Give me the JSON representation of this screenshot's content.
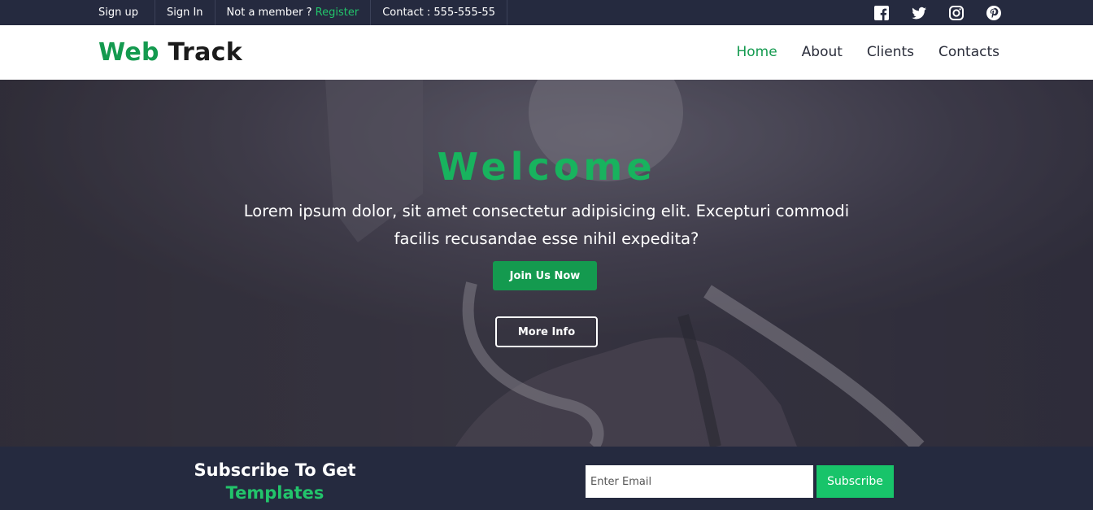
{
  "topbar": {
    "signup": "Sign up",
    "signin": "Sign In",
    "member_prefix": "Not a member ?",
    "register": "Register",
    "contact": "Contact : 555-555-55",
    "social_icons": [
      "facebook-icon",
      "twitter-icon",
      "instagram-icon",
      "pinterest-icon"
    ]
  },
  "nav": {
    "logo_part1": "Web",
    "logo_part2": "Track",
    "items": [
      {
        "label": "Home",
        "active": true
      },
      {
        "label": "About",
        "active": false
      },
      {
        "label": "Clients",
        "active": false
      },
      {
        "label": "Contacts",
        "active": false
      }
    ]
  },
  "hero": {
    "title": "Welcome",
    "text": "Lorem ipsum dolor, sit amet consectetur adipisicing elit. Excepturi commodi facilis recusandae esse nihil expedita?",
    "join_label": "Join Us Now",
    "more_label": "More Info"
  },
  "subscribe": {
    "title_line1": "Subscribe To Get",
    "title_line2": "Templates",
    "email_placeholder": "Enter Email",
    "button_label": "Subscribe"
  },
  "colors": {
    "accent": "#149a4f",
    "accent_bright": "#18c46a",
    "dark": "#252a3f"
  }
}
